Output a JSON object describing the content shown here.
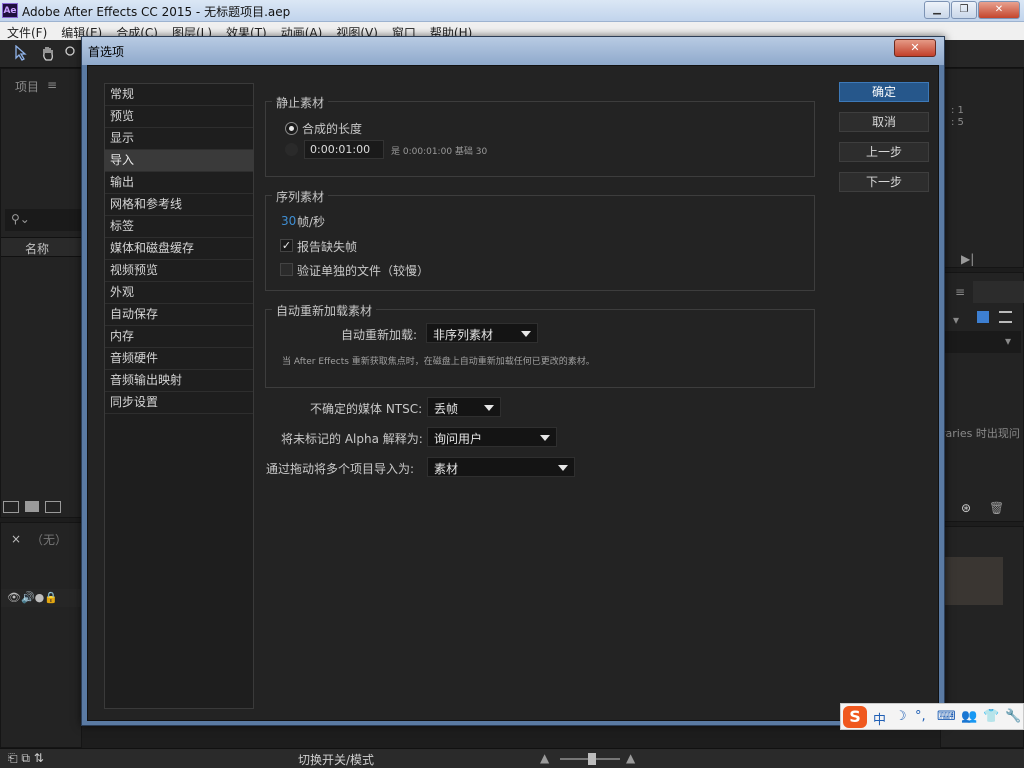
{
  "window": {
    "app_icon": "Ae",
    "title": "Adobe After Effects CC 2015 - 无标题项目.aep",
    "buttons": {
      "minimize": "▁",
      "maximize": "❐",
      "close": "✕"
    }
  },
  "menu": [
    "文件(F)",
    "编辑(E)",
    "合成(C)",
    "图层(L)",
    "效果(T)",
    "动画(A)",
    "视图(V)",
    "窗口",
    "帮助(H)"
  ],
  "background": {
    "project_panel_title": "项目",
    "project_menu_icon": "≡",
    "search_glyph": "⚲⌄",
    "name_column": "名称",
    "timeline_none": "（无）",
    "timeline_close": "×",
    "right_info": [
      ": 1",
      ": 5"
    ],
    "right_libraries_text": "raries 时出现问",
    "status_toggle": "切换开关/模式",
    "skip_icon": "▶|"
  },
  "dialog": {
    "title": "首选项",
    "close": "✕",
    "categories": [
      "常规",
      "预览",
      "显示",
      "导入",
      "输出",
      "网格和参考线",
      "标签",
      "媒体和磁盘缓存",
      "视频预览",
      "外观",
      "自动保存",
      "内存",
      "音频硬件",
      "音频输出映射",
      "同步设置"
    ],
    "selected_category": "导入",
    "still_footage": {
      "label": "静止素材",
      "option_comp_length": "合成的长度",
      "duration_value": "0:00:01:00",
      "duration_note": "是 0:00:01:00  基础 30"
    },
    "sequence_footage": {
      "label": "序列素材",
      "fps_value": "30",
      "fps_unit": "帧/秒",
      "report_missing_frames": "报告缺失帧",
      "verify_single_files": "验证单独的文件（较慢）"
    },
    "auto_reload": {
      "label": "自动重新加载素材",
      "field_label": "自动重新加载:",
      "selected": "非序列素材",
      "note": "当 After Effects 重新获取焦点时，在磁盘上自动重新加载任何已更改的素材。"
    },
    "ntsc": {
      "label": "不确定的媒体 NTSC:",
      "selected": "丢帧"
    },
    "alpha": {
      "label": "将未标记的 Alpha 解释为:",
      "selected": "询问用户"
    },
    "drag_import": {
      "label": "通过拖动将多个项目导入为:",
      "selected": "素材"
    },
    "buttons": {
      "ok": "确定",
      "cancel": "取消",
      "prev": "上一步",
      "next": "下一步"
    }
  },
  "ime": {
    "logo": "S",
    "items": [
      "中",
      "☽",
      "°,",
      "⌨",
      "👥",
      "👕",
      "🔧"
    ]
  }
}
